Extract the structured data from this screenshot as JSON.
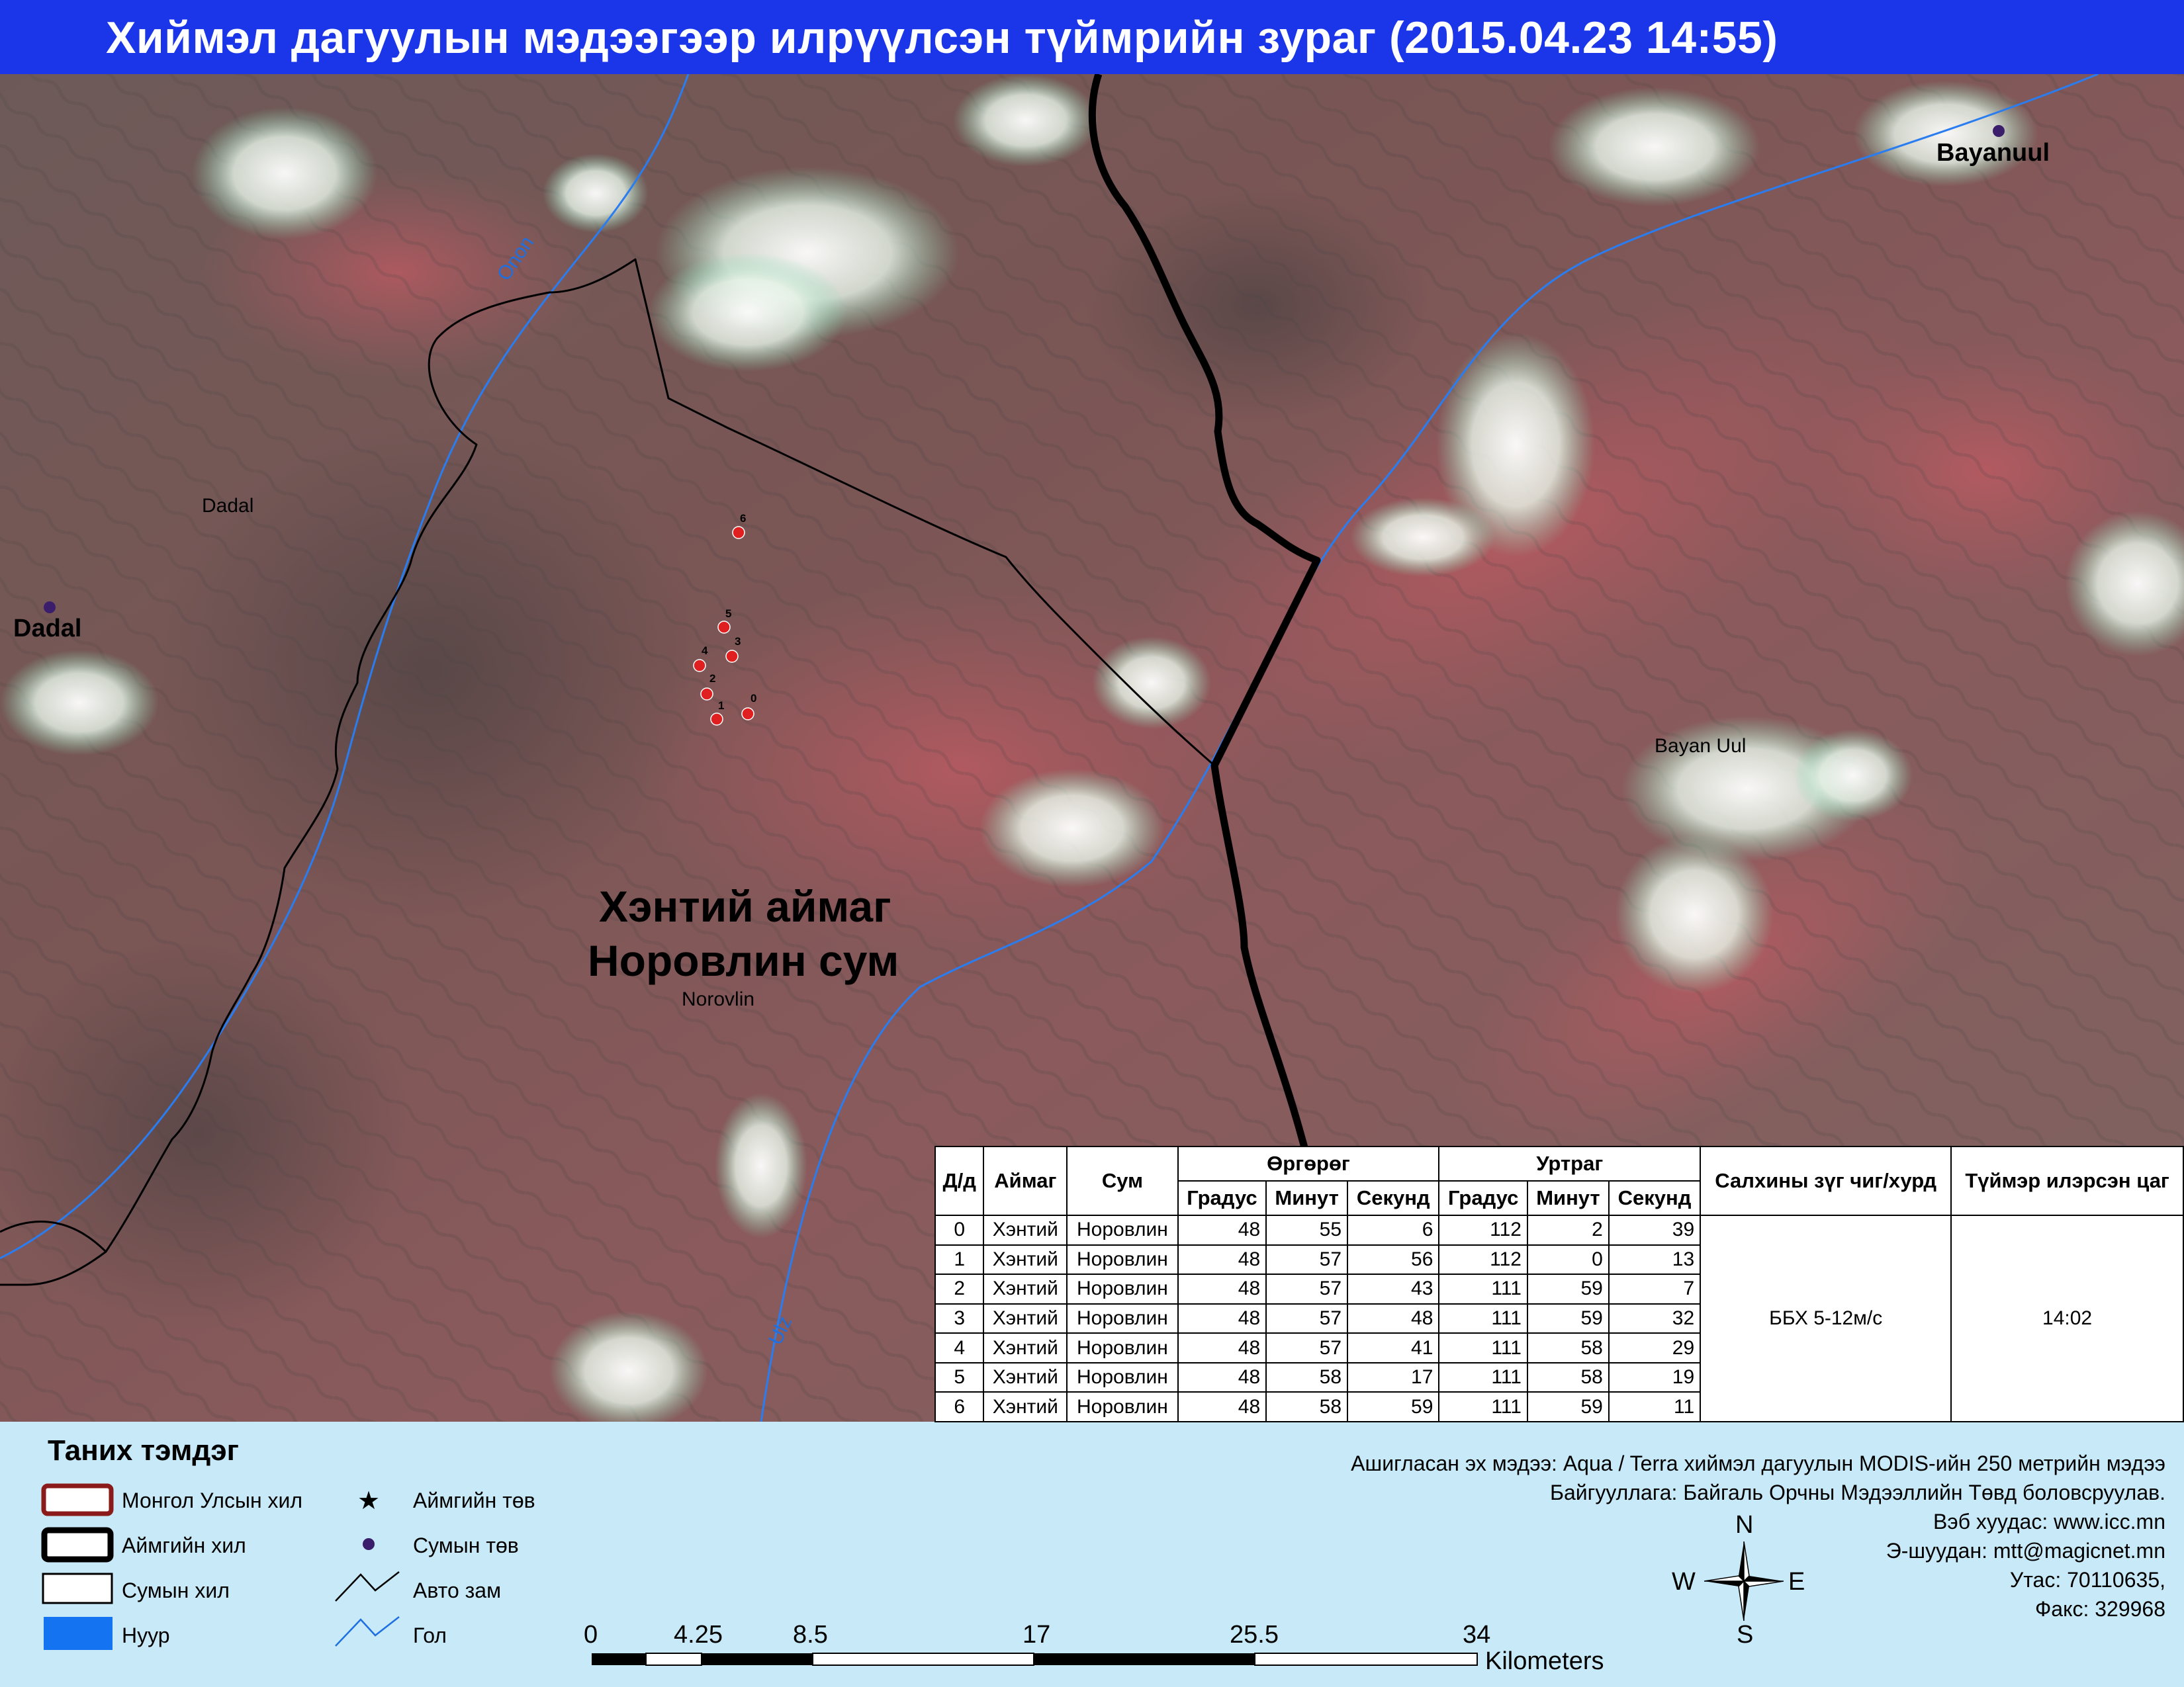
{
  "title": "Хиймэл дагуулын мэдээгээр илрүүлсэн түймрийн зураг  (2015.04.23 14:55)",
  "map": {
    "aoi_label": [
      "Хэнтий аймаг",
      "Норовлин сум"
    ],
    "places": {
      "norovlin": "Norovlin",
      "dadal_small": "Dadal",
      "dadal_center": "Dadal",
      "bayanuul_center": "Bayanuul",
      "bayan_uul": "Bayan Uul"
    },
    "rivers": {
      "onon": "Onon",
      "ulz": "Ulz"
    },
    "fire_point_color": "#e02020"
  },
  "table": {
    "headers": {
      "dd": "Д/д",
      "aimag": "Аймаг",
      "sum": "Сум",
      "lat": "Өргөрөг",
      "lon": "Уртраг",
      "wind": "Салхины зүг чиг/хурд",
      "time": "Түймэр илэрсэн цаг",
      "deg": "Градус",
      "min": "Минут",
      "sec": "Секунд"
    },
    "rows": [
      {
        "id": "0",
        "aimag": "Хэнтий",
        "sum": "Норовлин",
        "lat_d": "48",
        "lat_m": "55",
        "lat_s": "6",
        "lon_d": "112",
        "lon_m": "2",
        "lon_s": "39"
      },
      {
        "id": "1",
        "aimag": "Хэнтий",
        "sum": "Норовлин",
        "lat_d": "48",
        "lat_m": "57",
        "lat_s": "56",
        "lon_d": "112",
        "lon_m": "0",
        "lon_s": "13"
      },
      {
        "id": "2",
        "aimag": "Хэнтий",
        "sum": "Норовлин",
        "lat_d": "48",
        "lat_m": "57",
        "lat_s": "43",
        "lon_d": "111",
        "lon_m": "59",
        "lon_s": "7"
      },
      {
        "id": "3",
        "aimag": "Хэнтий",
        "sum": "Норовлин",
        "lat_d": "48",
        "lat_m": "57",
        "lat_s": "48",
        "lon_d": "111",
        "lon_m": "59",
        "lon_s": "32"
      },
      {
        "id": "4",
        "aimag": "Хэнтий",
        "sum": "Норовлин",
        "lat_d": "48",
        "lat_m": "57",
        "lat_s": "41",
        "lon_d": "111",
        "lon_m": "58",
        "lon_s": "29"
      },
      {
        "id": "5",
        "aimag": "Хэнтий",
        "sum": "Норовлин",
        "lat_d": "48",
        "lat_m": "58",
        "lat_s": "17",
        "lon_d": "111",
        "lon_m": "58",
        "lon_s": "19"
      },
      {
        "id": "6",
        "aimag": "Хэнтий",
        "sum": "Норовлин",
        "lat_d": "48",
        "lat_m": "58",
        "lat_s": "59",
        "lon_d": "111",
        "lon_m": "59",
        "lon_s": "11"
      }
    ],
    "wind": "ББХ 5-12м/с",
    "detected_time": "14:02"
  },
  "legend": {
    "title": "Таних тэмдэг",
    "items": {
      "national_border": "Монгол Улсын хил",
      "aimag_border": "Аймгийн хил",
      "sum_border": "Сумын хил",
      "lake": "Нуур",
      "aimag_center": "Аймгийн төв",
      "sum_center": "Сумын төв",
      "road": "Авто зам",
      "river": "Гол"
    }
  },
  "credits": [
    "Ашигласан эх мэдээ: Aqua / Terra хиймэл дагуулын MODIS-ийн 250 метрийн мэдээ",
    "Байгууллага: Байгаль Орчны Мэдээллийн Төвд боловсруулав.",
    "Вэб хуудас: www.icc.mn",
    "Э-шуудан: mtt@magicnet.mn",
    "Утас: 70110635,",
    "Факс: 329968"
  ],
  "scale": {
    "ticks": [
      "0",
      "4.25",
      "8.5",
      "17",
      "25.5",
      "34"
    ],
    "unit": "Kilometers"
  },
  "compass": {
    "n": "N",
    "s": "S",
    "e": "E",
    "w": "W"
  }
}
